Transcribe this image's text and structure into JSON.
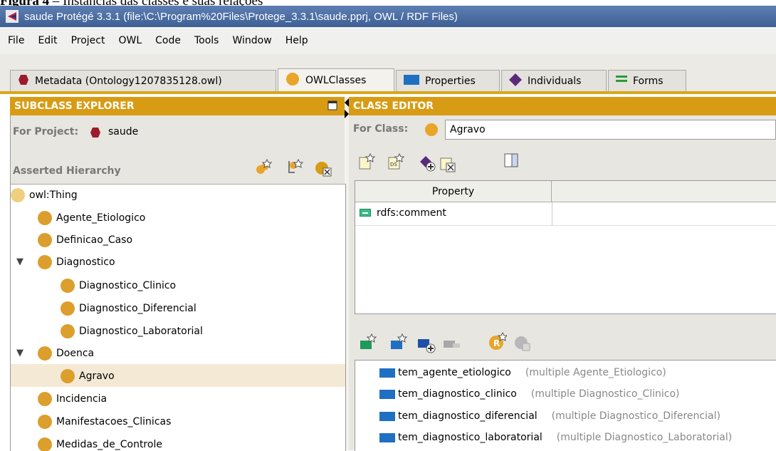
{
  "caption": {
    "figure": "Figura 4",
    "text": "– Instâncias das classes e suas relações"
  },
  "window": {
    "title": "saude  Protégé 3.3.1     (file:\\C:\\Program%20Files\\Protege_3.3.1\\saude.pprj, OWL / RDF Files)"
  },
  "menu": [
    "File",
    "Edit",
    "Project",
    "OWL",
    "Code",
    "Tools",
    "Window",
    "Help"
  ],
  "tabs": [
    {
      "label": "Metadata (Ontology1207835128.owl)",
      "icon": "diamond-icon",
      "color": "#9c1c2c"
    },
    {
      "label": "OWLClasses",
      "icon": "class-circle-icon",
      "color": "#dc9e2c"
    },
    {
      "label": "Properties",
      "icon": "property-rect-icon",
      "color": "#1f6fc2"
    },
    {
      "label": "Individuals",
      "icon": "individual-diamond-icon",
      "color": "#5a2a7a"
    },
    {
      "label": "Forms",
      "icon": "forms-icon",
      "color": "#2a9a3a"
    }
  ],
  "left": {
    "header": "SUBCLASS EXPLORER",
    "project_label": "For Project:",
    "project_value": "saude",
    "hierarchy_label": "Asserted Hierarchy",
    "tree": [
      {
        "label": "owl:Thing"
      },
      {
        "label": "Agente_Etiologico"
      },
      {
        "label": "Definicao_Caso"
      },
      {
        "label": "Diagnostico"
      },
      {
        "label": "Diagnostico_Clinico"
      },
      {
        "label": "Diagnostico_Diferencial"
      },
      {
        "label": "Diagnostico_Laboratorial"
      },
      {
        "label": "Doenca"
      },
      {
        "label": "Agravo"
      },
      {
        "label": "Incidencia"
      },
      {
        "label": "Manifestacoes_Clinicas"
      },
      {
        "label": "Medidas_de_Controle"
      }
    ]
  },
  "right": {
    "header": "CLASS EDITOR",
    "class_label": "For Class:",
    "class_value": "Agravo",
    "table_header": "Property",
    "annotation": "rdfs:comment",
    "properties": [
      {
        "name": "tem_agente_etiologico",
        "range": "(multiple Agente_Etiologico)"
      },
      {
        "name": "tem_diagnostico_clinico",
        "range": "(multiple Diagnostico_Clinico)"
      },
      {
        "name": "tem_diagnostico_diferencial",
        "range": "(multiple Diagnostico_Diferencial)"
      },
      {
        "name": "tem_diagnostico_laboratorial",
        "range": "(multiple Diagnostico_Laboratorial)"
      }
    ]
  }
}
